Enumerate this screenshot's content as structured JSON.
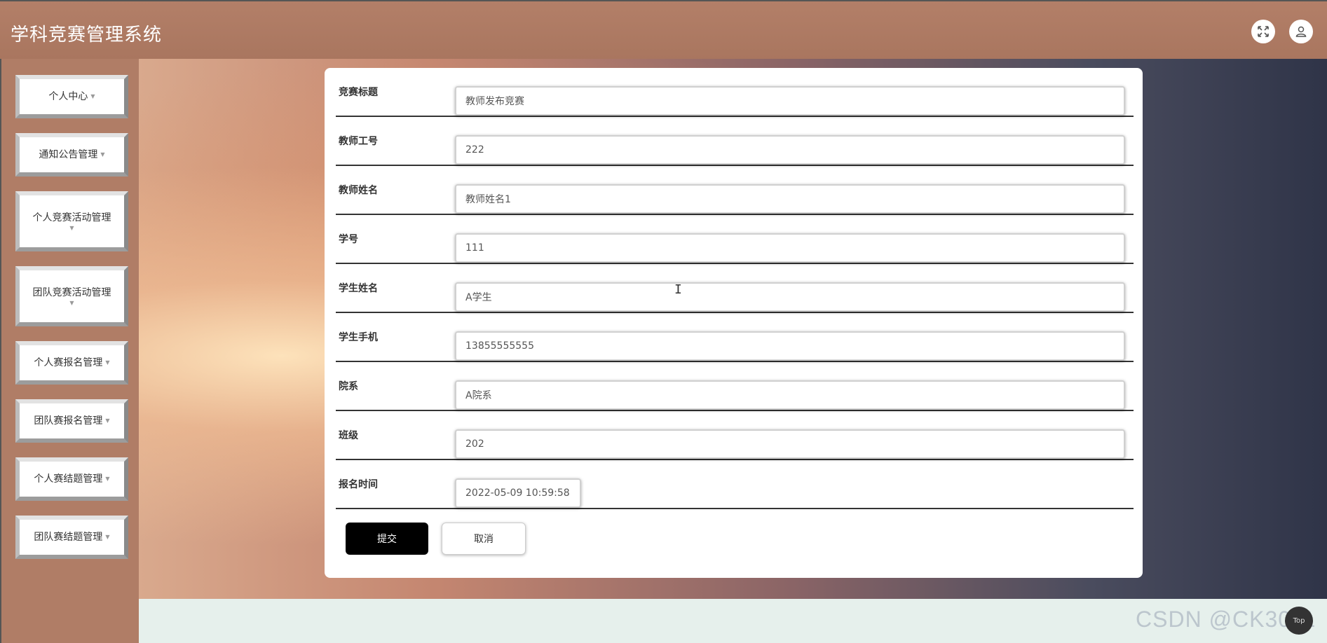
{
  "header": {
    "title": "学科竞赛管理系统",
    "expand_icon": "expand-icon",
    "user_icon": "user-icon"
  },
  "sidebar": {
    "items": [
      {
        "label": "个人中心"
      },
      {
        "label": "通知公告管理"
      },
      {
        "label": "个人竞赛活动管理"
      },
      {
        "label": "团队竞赛活动管理"
      },
      {
        "label": "个人赛报名管理"
      },
      {
        "label": "团队赛报名管理"
      },
      {
        "label": "个人赛结题管理"
      },
      {
        "label": "团队赛结题管理"
      }
    ]
  },
  "form": {
    "fields": [
      {
        "label": "竞赛标题",
        "value": "教师发布竞赛"
      },
      {
        "label": "教师工号",
        "value": "222"
      },
      {
        "label": "教师姓名",
        "value": "教师姓名1"
      },
      {
        "label": "学号",
        "value": "111"
      },
      {
        "label": "学生姓名",
        "value": "A学生"
      },
      {
        "label": "学生手机",
        "value": "13855555555"
      },
      {
        "label": "院系",
        "value": "A院系"
      },
      {
        "label": "班级",
        "value": "202"
      },
      {
        "label": "报名时间",
        "value": "2022-05-09 10:59:58"
      }
    ],
    "submit_label": "提交",
    "cancel_label": "取消"
  },
  "watermark": "CSDN @CK3011",
  "top_button_label": "Top",
  "colors": {
    "header_bg": "#b07d66",
    "submit_bg": "#000000",
    "bottom_strip": "#e6f0ec"
  }
}
